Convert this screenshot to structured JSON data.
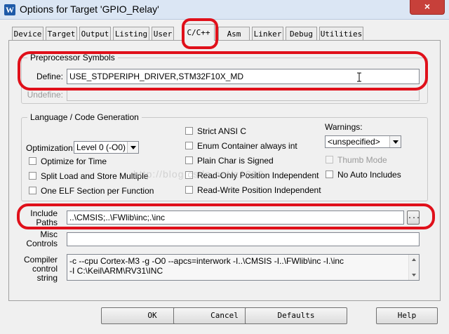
{
  "window": {
    "title": "Options for Target 'GPIO_Relay'",
    "app_icon": "W",
    "close": "×"
  },
  "tabs": [
    {
      "label": "Device"
    },
    {
      "label": "Target"
    },
    {
      "label": "Output"
    },
    {
      "label": "Listing"
    },
    {
      "label": "User"
    },
    {
      "label": "C/C++"
    },
    {
      "label": "Asm"
    },
    {
      "label": "Linker"
    },
    {
      "label": "Debug"
    },
    {
      "label": "Utilities"
    }
  ],
  "preprocessor": {
    "title": "Preprocessor Symbols",
    "define_label": "Define:",
    "define_value": "USE_STDPERIPH_DRIVER,STM32F10X_MD",
    "undefine_label": "Undefine:",
    "undefine_value": ""
  },
  "language": {
    "title": "Language / Code Generation",
    "optimization_label": "Optimization:",
    "optimization_value": "Level 0 (-O0)",
    "optimize_time": "Optimize for Time",
    "split_load": "Split Load and Store Multiple",
    "one_elf": "One ELF Section per Function",
    "strict_ansi": "Strict ANSI C",
    "enum_container": "Enum Container always int",
    "plain_char": "Plain Char is Signed",
    "ro_pos_indep": "Read-Only Position Independent",
    "rw_pos_indep": "Read-Write Position Independent",
    "warnings_label": "Warnings:",
    "warnings_value": "<unspecified>",
    "thumb_mode": "Thumb Mode",
    "no_auto_includes": "No Auto Includes"
  },
  "include": {
    "label_line1": "Include",
    "label_line2": "Paths",
    "value": "..\\CMSIS;..\\FWlib\\inc;.\\inc",
    "browse": "..."
  },
  "misc": {
    "label_line1": "Misc",
    "label_line2": "Controls",
    "value": ""
  },
  "compiler": {
    "label_line1": "Compiler",
    "label_line2": "control",
    "label_line3": "string",
    "line1": "-c --cpu Cortex-M3 -g -O0 --apcs=interwork -I..\\CMSIS -I..\\FWlib\\inc -I.\\inc",
    "line2": "-I C:\\Keil\\ARM\\RV31\\INC"
  },
  "buttons": {
    "ok": "OK",
    "cancel": "Cancel",
    "defaults": "Defaults",
    "help": "Help"
  },
  "watermark": "http://blog.csdn.net/z1003"
}
